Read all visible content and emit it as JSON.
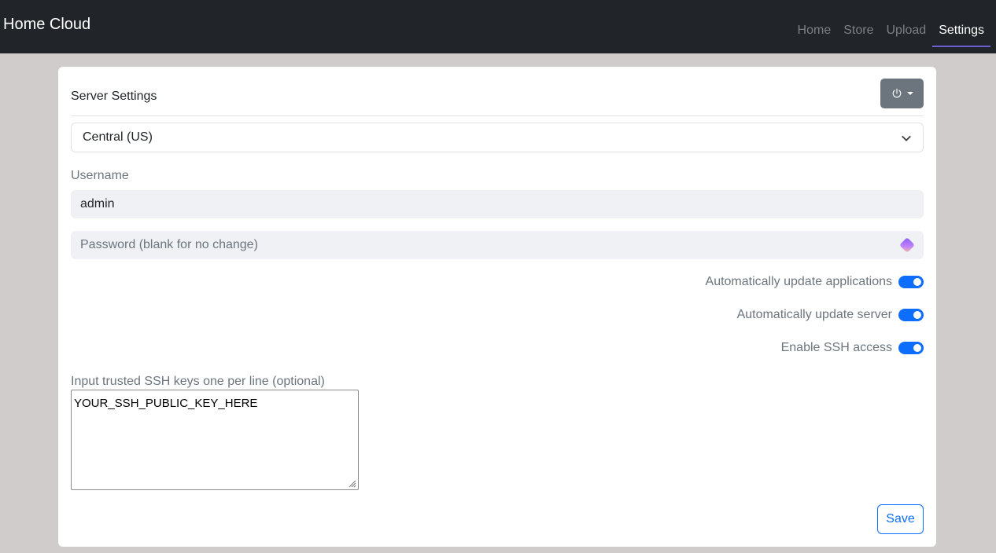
{
  "app": {
    "title": "Home Cloud"
  },
  "nav": {
    "items": [
      {
        "label": "Home",
        "active": false
      },
      {
        "label": "Store",
        "active": false
      },
      {
        "label": "Upload",
        "active": false
      },
      {
        "label": "Settings",
        "active": true
      }
    ],
    "accent_color": "#6f5fce"
  },
  "settings": {
    "title": "Server Settings",
    "power_menu_icon": "power-icon",
    "region": {
      "selected": "Central (US)"
    },
    "username": {
      "label": "Username",
      "value": "admin"
    },
    "password": {
      "placeholder": "Password (blank for no change)",
      "value": ""
    },
    "toggles": [
      {
        "label": "Automatically update applications",
        "checked": true
      },
      {
        "label": "Automatically update server",
        "checked": true
      },
      {
        "label": "Enable SSH access",
        "checked": true
      }
    ],
    "ssh_keys": {
      "label": "Input trusted SSH keys one per line (optional)",
      "value": "YOUR_SSH_PUBLIC_KEY_HERE"
    },
    "save_label": "Save",
    "primary_color": "#0d6efd"
  }
}
